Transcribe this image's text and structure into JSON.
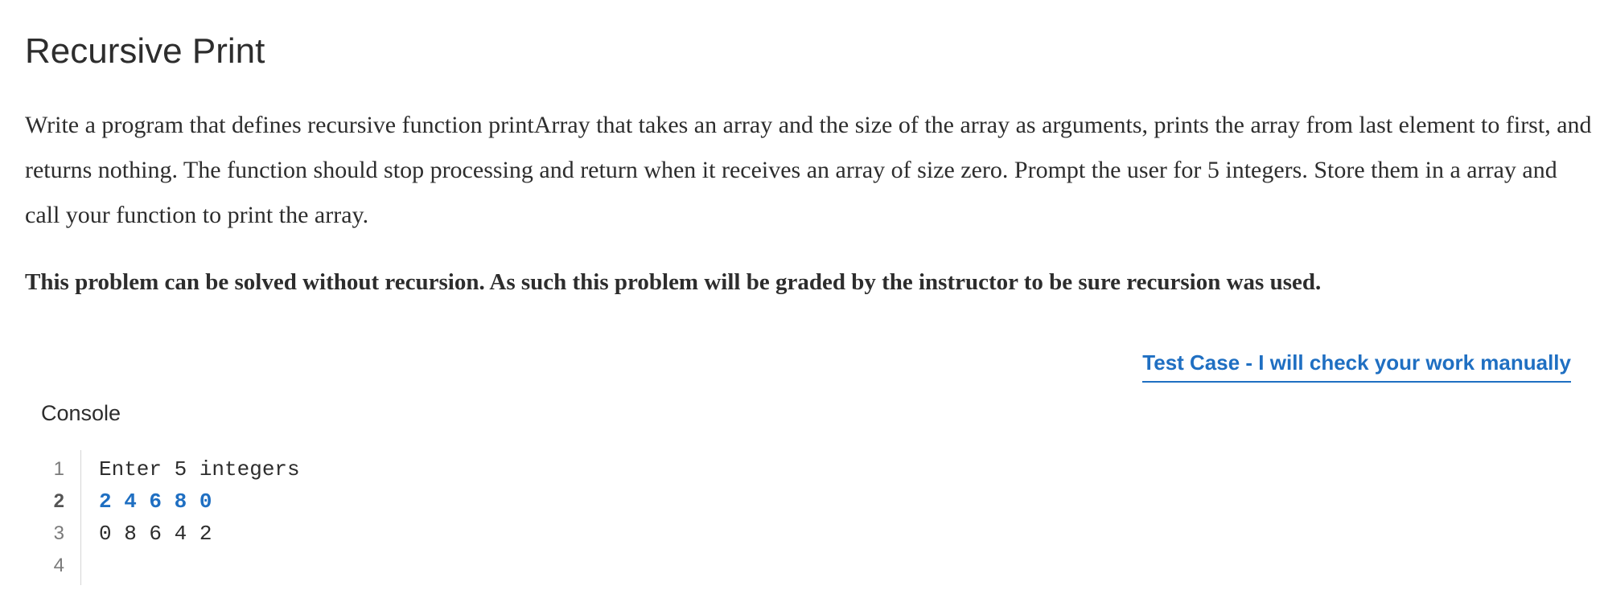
{
  "title": "Recursive Print",
  "description": "Write a program that defines recursive function printArray that takes an array and the size of the array as arguments, prints the array from last element to first, and returns nothing. The function should stop processing and return when it receives an array of size zero. Prompt the user for 5 integers. Store them in a array and call your function to print the array.",
  "warning": "This problem can be solved without recursion. As such this problem will be graded by the instructor to be sure recursion was used.",
  "test_case_link": "Test Case - I will check your work manually",
  "console": {
    "label": "Console",
    "lines": [
      {
        "number": "1",
        "text": "Enter 5 integers",
        "is_input": false
      },
      {
        "number": "2",
        "text": "2 4 6 8 0",
        "is_input": true
      },
      {
        "number": "3",
        "text": "0 8 6 4 2",
        "is_input": false
      },
      {
        "number": "4",
        "text": "",
        "is_input": false
      }
    ]
  }
}
